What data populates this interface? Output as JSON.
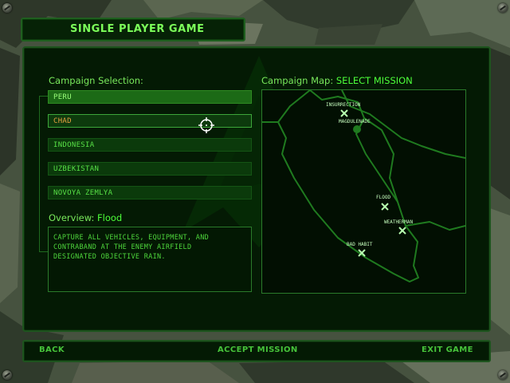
{
  "header": {
    "title": "SINGLE PLAYER GAME"
  },
  "campaign_selection": {
    "heading": "Campaign Selection:",
    "items": [
      {
        "label": "PERU",
        "state": "selected"
      },
      {
        "label": "CHAD",
        "state": "hover"
      },
      {
        "label": "INDONESIA",
        "state": "normal"
      },
      {
        "label": "UZBEKISTAN",
        "state": "normal"
      },
      {
        "label": "NOVOYA ZEMLYA",
        "state": "normal"
      }
    ]
  },
  "overview": {
    "heading": "Overview:",
    "mission_name": "Flood",
    "text_lines": [
      "CAPTURE ALL VEHICLES, EQUIPMENT, AND",
      "CONTRABAND AT THE ENEMY AIRFIELD",
      "DESIGNATED OBJECTIVE RAIN."
    ]
  },
  "campaign_map": {
    "heading": "Campaign Map:",
    "status": "SELECT MISSION",
    "markers": [
      {
        "label": "INSURRECTION",
        "type": "mission"
      },
      {
        "label": "MAGDULENADE",
        "type": "location"
      },
      {
        "label": "FLOOD",
        "type": "mission"
      },
      {
        "label": "WEATHERMAN",
        "type": "mission"
      },
      {
        "label": "BAD HABIT",
        "type": "mission"
      }
    ]
  },
  "footer": {
    "back": "BACK",
    "accept": "ACCEPT MISSION",
    "exit": "EXIT GAME"
  },
  "colors": {
    "accent": "#4dff3a",
    "text_green": "#79e85c",
    "panel_bg": "#041a04",
    "hover_text": "#e8a040"
  }
}
